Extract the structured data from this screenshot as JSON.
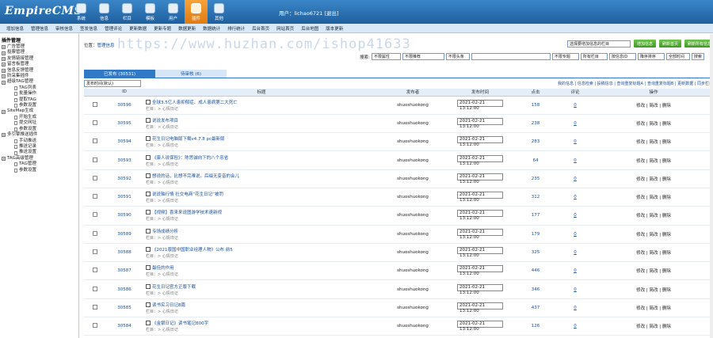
{
  "app": {
    "logo": "EmpireCMS",
    "user_text": "用户：lichao6721  [退出]"
  },
  "topnav": [
    "系统",
    "信息",
    "栏目",
    "模板",
    "用户",
    "插件",
    "其他"
  ],
  "submenu": [
    "增加信息",
    "管理信息",
    "审核信息",
    "签发信息",
    "管理评论",
    "更新数据",
    "更新专题",
    "数据更新",
    "数据统计",
    "排行统计",
    "后台首页",
    "网站首页",
    "后台地图",
    "版本更新"
  ],
  "sidebar": {
    "root": "插件管理",
    "items": [
      {
        "type": "parent",
        "label": "广告管理"
      },
      {
        "type": "parent",
        "label": "投票管理"
      },
      {
        "type": "parent",
        "label": "友情链接管理"
      },
      {
        "type": "parent",
        "label": "留言板管理"
      },
      {
        "type": "parent",
        "label": "信息反馈管理"
      },
      {
        "type": "parent",
        "label": "防采集插件"
      },
      {
        "type": "parent",
        "label": "超级TAG管理"
      },
      {
        "type": "child",
        "label": "TAG列表"
      },
      {
        "type": "child",
        "label": "批量操作"
      },
      {
        "type": "child",
        "label": "提取TAG"
      },
      {
        "type": "child",
        "label": "参数设置"
      },
      {
        "type": "parent",
        "label": "SiteMap生成"
      },
      {
        "type": "child",
        "label": "开始生成"
      },
      {
        "type": "child",
        "label": "提交网址"
      },
      {
        "type": "child",
        "label": "参数设置"
      },
      {
        "type": "parent",
        "label": "多引擎推送插件"
      },
      {
        "type": "child",
        "label": "手动推送"
      },
      {
        "type": "child",
        "label": "推送记录"
      },
      {
        "type": "child",
        "label": "推送设置"
      },
      {
        "type": "parent",
        "label": "TAG高级管理"
      },
      {
        "type": "child",
        "label": "TAG管理"
      },
      {
        "type": "child",
        "label": "参数设置"
      }
    ]
  },
  "main": {
    "location": "位置：",
    "location_link": "管理信息",
    "watermark": "https://www.huzhan.com/ishop41633",
    "column_select": "选择要增加信息的栏目",
    "btn_add": "增加信息",
    "btn_refresh": "刷新首页",
    "btn_refresh_all": "刷新所有信息",
    "search": {
      "label": "搜索:",
      "f1": "不限属性",
      "f2": "不限推荐",
      "f3": "不限头条",
      "keyword": "",
      "f4": "不限专题",
      "f5": "所有栏目",
      "f6": "按信息ID",
      "f7": "降序排序",
      "f8": "全部时间",
      "btn": "搜索"
    },
    "tab_active": "已发布 (30531)",
    "tab_pending": "待审核 (6)",
    "sort_select": "发布时间(默认)",
    "tool_links": "我的信息 | 信息检索 | 投稿信息 | 查询重复标题A | 查询重复标题B | 更新数据 | 同步栏目"
  },
  "table": {
    "headers": [
      "",
      "ID",
      "标题",
      "发布者",
      "发布时间",
      "点击",
      "评论",
      "操作"
    ],
    "rows": [
      {
        "id": "30596",
        "title": "全球3.5亿人患抑郁症、成人患病第二大死亡",
        "sub": "栏目：> 心情日记",
        "author": "shuoshuokong",
        "time": "2021-02-21 13:12:00",
        "clicks": "158",
        "comments": "0",
        "ops": "修改 | 简改 | 删除"
      },
      {
        "id": "30595",
        "title": "说说发布项目",
        "sub": "栏目：> 心情日记",
        "author": "shuoshuokong",
        "time": "2021-02-21 13:12:00",
        "clicks": "238",
        "comments": "0",
        "ops": "修改 | 简改 | 删除"
      },
      {
        "id": "30594",
        "title": "花生日记电脑版下载v4.7.8 pc最新版",
        "sub": "栏目：> 心情日记",
        "author": "shuoshuokong",
        "time": "2021-02-21 13:12:00",
        "clicks": "283",
        "comments": "0",
        "ops": "修改 | 简改 | 删除"
      },
      {
        "id": "30593",
        "title": "《康人说保险》：陈思诚向下的八个忠省",
        "sub": "栏目：> 心情日记",
        "author": "shuoshuokong",
        "time": "2021-02-21 13:12:00",
        "clicks": "64",
        "comments": "0",
        "ops": "修改 | 简改 | 删除"
      },
      {
        "id": "30592",
        "title": "想说的话，比想不完难说。后缀无变音的会儿",
        "sub": "栏目：> 心情日记",
        "author": "shuoshuokong",
        "time": "2021-02-21 13:12:00",
        "clicks": "235",
        "comments": "0",
        "ops": "修改 | 简改 | 删除"
      },
      {
        "id": "30591",
        "title": "说说轴行情 社交电商“花生日记”被罚",
        "sub": "栏目：> 心情日记",
        "author": "shuoshuokong",
        "time": "2021-02-21 13:12:00",
        "clicks": "312",
        "comments": "0",
        "ops": "修改 | 简改 | 删除"
      },
      {
        "id": "30590",
        "title": "【视频】喜来来说图游学技术速新视",
        "sub": "栏目：> 心情日记",
        "author": "shuoshuokong",
        "time": "2021-02-21 13:12:00",
        "clicks": "177",
        "comments": "0",
        "ops": "修改 | 简改 | 删除"
      },
      {
        "id": "30589",
        "title": "专场成绩分析",
        "sub": "栏目：> 心情日记",
        "author": "shuoshuokong",
        "time": "2021-02-21 13:12:00",
        "clicks": "179",
        "comments": "0",
        "ops": "修改 | 简改 | 删除"
      },
      {
        "id": "30588",
        "title": "《2021版国中国职业经理人物》公布 前5",
        "sub": "栏目：> 心情日记",
        "author": "shuoshuokong",
        "time": "2021-02-21 13:12:00",
        "clicks": "325",
        "comments": "0",
        "ops": "修改 | 简改 | 删除"
      },
      {
        "id": "30587",
        "title": "最佳的作用",
        "sub": "栏目：> 心情日记",
        "author": "shuoshuokong",
        "time": "2021-02-21 13:12:00",
        "clicks": "446",
        "comments": "0",
        "ops": "修改 | 简改 | 删除"
      },
      {
        "id": "30586",
        "title": "花生日记官方正版下载",
        "sub": "栏目：> 心情日记",
        "author": "shuoshuokong",
        "time": "2021-02-21 13:12:00",
        "clicks": "346",
        "comments": "0",
        "ops": "修改 | 简改 | 删除"
      },
      {
        "id": "30585",
        "title": "读书实习日记8篇",
        "sub": "栏目：> 心情日记",
        "author": "shuoshuokong",
        "time": "2021-02-21 13:12:00",
        "clicks": "437",
        "comments": "0",
        "ops": "修改 | 简改 | 删除"
      },
      {
        "id": "30584",
        "title": "《金银日记》读书笔记800字",
        "sub": "栏目：> 心情日记",
        "author": "shuoshuokong",
        "time": "2021-02-21 13:12:00",
        "clicks": "126",
        "comments": "0",
        "ops": "修改 | 简改 | 删除"
      }
    ]
  }
}
